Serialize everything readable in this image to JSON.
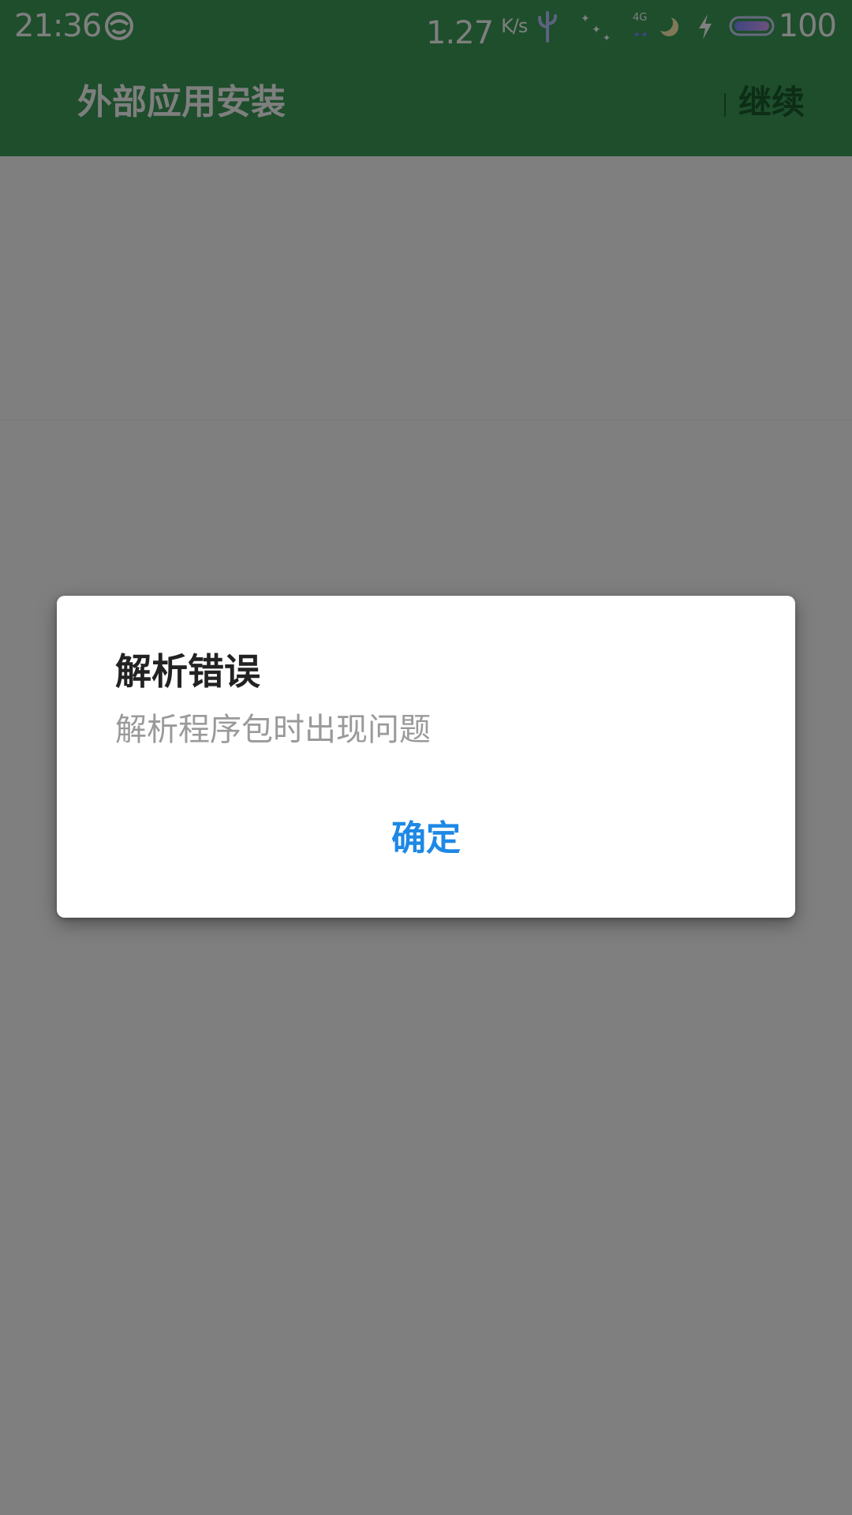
{
  "status_bar": {
    "time": "21:36",
    "net_speed": "1.27",
    "net_speed_unit": "K/s",
    "network_type": "4G",
    "battery_level": "100",
    "icons": [
      "face-icon",
      "cactus-icon",
      "stars-icon",
      "signal-moon-icon",
      "charging-bolt-icon",
      "battery-icon"
    ]
  },
  "app_bar": {
    "title": "外部应用安装",
    "continue_label": "继续"
  },
  "dialog": {
    "title": "解析错误",
    "message": "解析程序包时出现问题",
    "ok_label": "确定"
  },
  "colors": {
    "app_bar_green": "#3d9c58",
    "accent_blue": "#1e88e5",
    "scrim": "rgba(0,0,0,0.5)"
  }
}
